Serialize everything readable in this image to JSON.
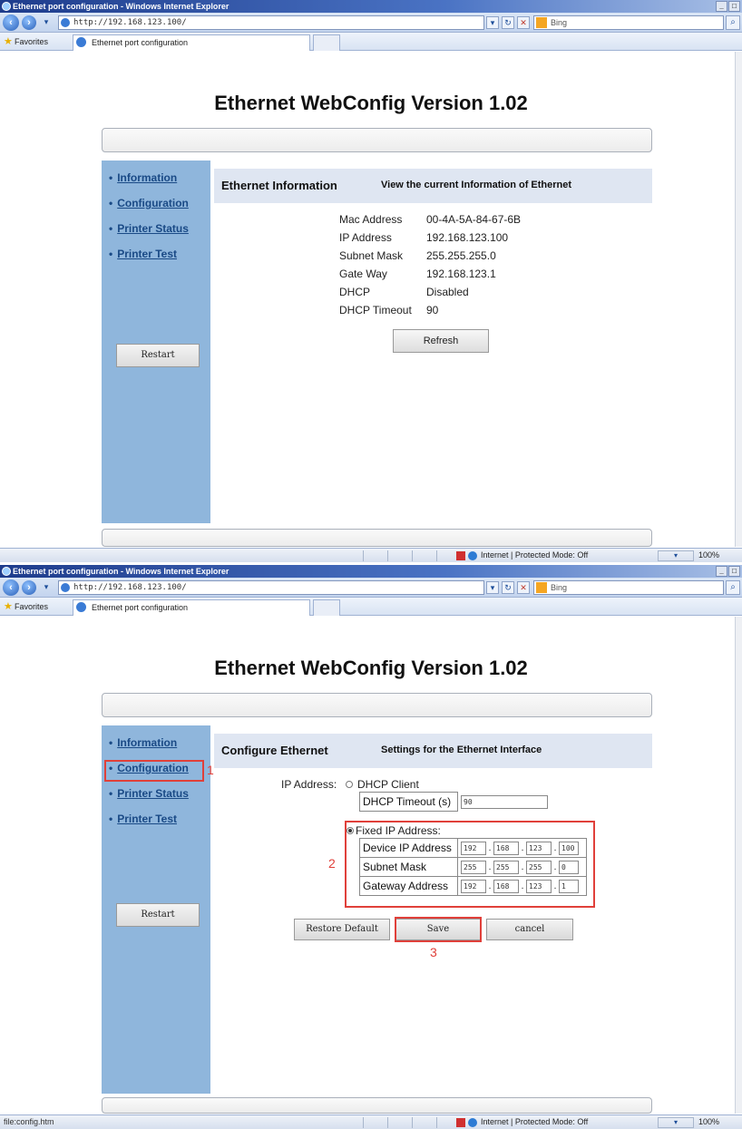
{
  "window1": {
    "title": "Ethernet port configuration - Windows Internet Explorer",
    "url": "http://192.168.123.100/",
    "search_placeholder": "Bing",
    "favorites_label": "Favorites",
    "tab_label": "Ethernet port configuration",
    "page_title": "Ethernet WebConfig Version 1.02",
    "nav": [
      "Information",
      "Configuration",
      "Printer Status",
      "Printer Test"
    ],
    "restart_label": "Restart",
    "section_title": "Ethernet Information",
    "section_desc": "View the current Information of Ethernet",
    "info": [
      {
        "label": "Mac Address",
        "value": "00-4A-5A-84-67-6B"
      },
      {
        "label": "IP Address",
        "value": "192.168.123.100"
      },
      {
        "label": "Subnet Mask",
        "value": "255.255.255.0"
      },
      {
        "label": "Gate Way",
        "value": "192.168.123.1"
      },
      {
        "label": "DHCP",
        "value": "Disabled"
      },
      {
        "label": "DHCP Timeout",
        "value": "90"
      }
    ],
    "refresh_label": "Refresh",
    "status": {
      "zone": "Internet | Protected Mode: Off",
      "zoom": "100%"
    }
  },
  "window2": {
    "title": "Ethernet port configuration - Windows Internet Explorer",
    "url": "http://192.168.123.100/",
    "search_placeholder": "Bing",
    "favorites_label": "Favorites",
    "tab_label": "Ethernet port configuration",
    "page_title": "Ethernet WebConfig Version 1.02",
    "nav": [
      "Information",
      "Configuration",
      "Printer Status",
      "Printer Test"
    ],
    "restart_label": "Restart",
    "section_title": "Configure Ethernet",
    "section_desc": "Settings for the Ethernet Interface",
    "ip_address_label": "IP Address:",
    "dhcp_client_label": "DHCP Client",
    "dhcp_timeout_label": "DHCP Timeout (s)",
    "dhcp_timeout_value": "90",
    "fixed_ip_label": "Fixed IP Address:",
    "device_ip_label": "Device IP Address",
    "device_ip": [
      "192",
      "168",
      "123",
      "100"
    ],
    "subnet_label": "Subnet Mask",
    "subnet": [
      "255",
      "255",
      "255",
      "0"
    ],
    "gateway_label": "Gateway Address",
    "gateway": [
      "192",
      "168",
      "123",
      "1"
    ],
    "restore_label": "Restore Default",
    "save_label": "Save",
    "cancel_label": "cancel",
    "annotations": [
      "1",
      "2",
      "3"
    ],
    "status": {
      "left": "file:config.htm",
      "zone": "Internet | Protected Mode: Off",
      "zoom": "100%"
    }
  },
  "colors": {
    "sidebar": "#8fb6dc",
    "section_header": "#dfe6f2",
    "annotation": "#e0403a",
    "link": "#1a4a86"
  }
}
